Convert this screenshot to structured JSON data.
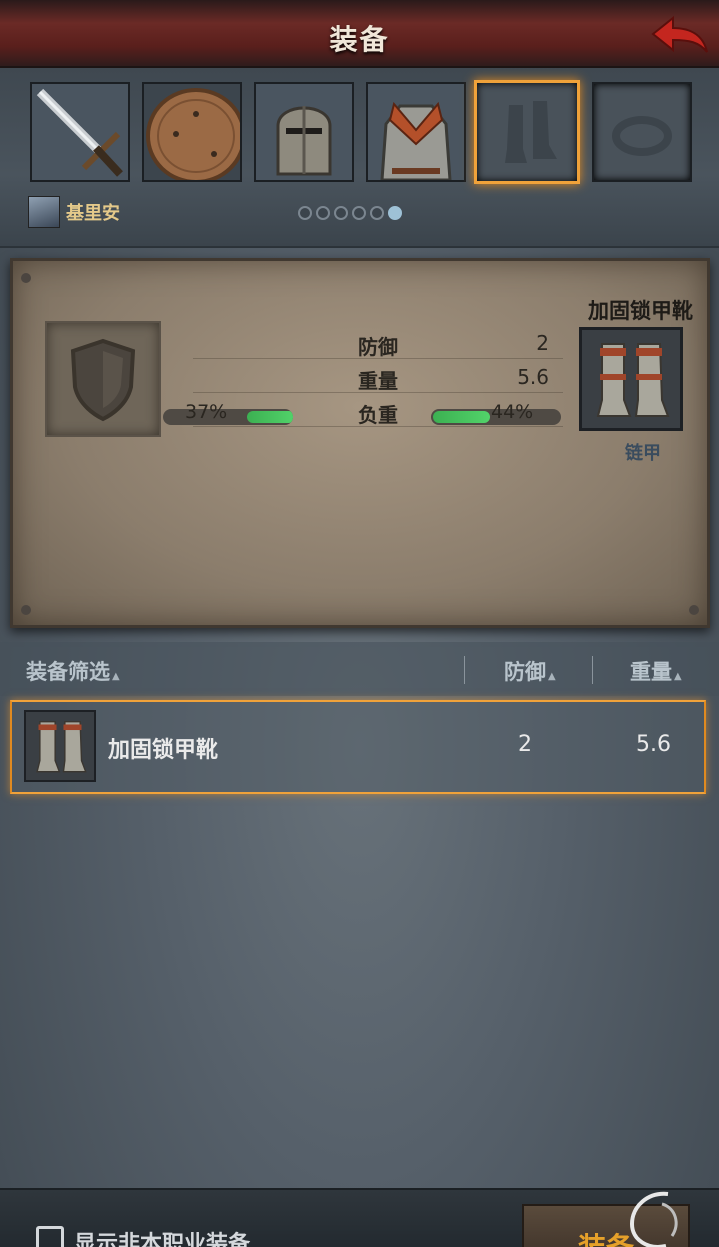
{
  "header": {
    "title": "装备"
  },
  "character": {
    "name": "基里安"
  },
  "slots": [
    {
      "name": "sword",
      "icon": "sword-icon"
    },
    {
      "name": "shield",
      "icon": "shield-icon"
    },
    {
      "name": "helmet",
      "icon": "helmet-icon"
    },
    {
      "name": "armor",
      "icon": "armor-icon"
    },
    {
      "name": "boots",
      "icon": "boots-icon",
      "selected": true
    },
    {
      "name": "ring",
      "icon": "ring-icon"
    }
  ],
  "pager": {
    "count": 6,
    "active_index": 5
  },
  "compare": {
    "stats": [
      {
        "label": "防御",
        "value": "2"
      },
      {
        "label": "重量",
        "value": "5.6"
      },
      {
        "label": "负重",
        "value": ""
      }
    ],
    "current_load": "37%",
    "new_load": "44%",
    "current_load_fraction": 0.37,
    "new_load_fraction": 0.44,
    "new_item_name": "加固锁甲靴",
    "new_item_type": "链甲"
  },
  "list": {
    "headers": {
      "filter": "装备筛选",
      "defense": "防御",
      "weight": "重量"
    },
    "rows": [
      {
        "name": "加固锁甲靴",
        "defense": "2",
        "weight": "5.6"
      }
    ]
  },
  "footer": {
    "checkbox_label": "显示非本职业装备",
    "equip_button": "装备"
  },
  "colors": {
    "accent": "#f0a23a",
    "header": "#6b2a26",
    "bar": "#3cb052"
  }
}
